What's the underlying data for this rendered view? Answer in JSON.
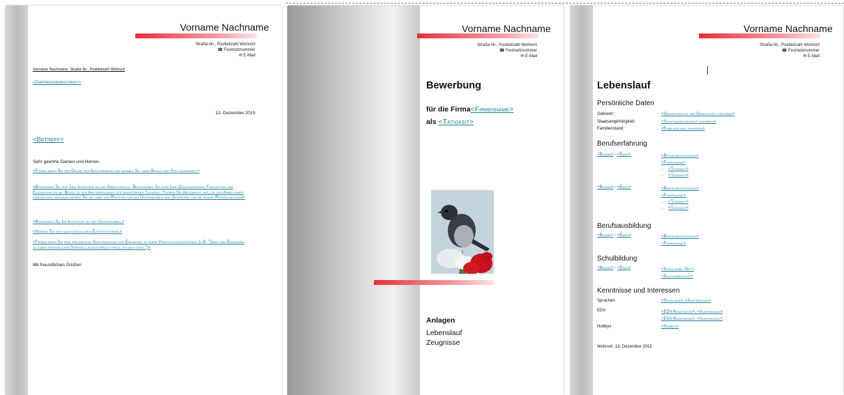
{
  "header": {
    "name": "Vorname Nachname",
    "address": "Straße-Nr., Postleitzahl  Wohnort",
    "phone": "☎ Festnetznummer",
    "email": "✉ E-Mail"
  },
  "letter": {
    "sender_line": "Vorname Nachname, Straße-Nr., Postleitzahl  Wohnort",
    "recipient": "<Empfängeranschrift>",
    "date": "13. Dezember 2015",
    "subject": "<Betreff>",
    "salutation": "Sehr geehrte Damen und Herren,",
    "paragraphs": [
      "<Formulieren Sie den Grund des Anschreibens und nehmen Sie darin Bezug zum Stellenangebot>",
      "<Begründen Sie hier Ihre Interesse an der Arbeitsstelle. Beschreiben Sie kurz Ihre Qualifikationen, Fähigkeiten und Eigenschaften mit Bezug zu den Anforderungen der angestreben Tätigkeit. Führen Sie Argumente auf, die den Arbeitgeber überzeugen, weshalb gerade Sie die oder der Richtige für das Unternehmen sind (Interesse für die eigene Person wecken)>",
      "<Begründen Sie Ihr Interesse an dem Unternehmen.>",
      "<Nennen Sie den nächstmöglichen Eintrittstermin.>",
      "<Formulieren Sie eine freundliche Aufforderung zur Einladung zu einem Vorstellungsgespräch (z.B. \"Über eine Einladung zu einem persönlichen Vorstellungsgespräch freue ich mich sehr.\")>"
    ],
    "closing": "Mit freundlichen Grüßen"
  },
  "cover": {
    "title": "Bewerbung",
    "firma_prefix": "für die Firma",
    "firma_value": "<Firmenname>",
    "als_prefix": "als",
    "als_value": "<Tätigkeit>",
    "anlagen_title": "Anlagen",
    "anlagen": [
      "Lebenslauf",
      "Zeugnisse"
    ]
  },
  "cv": {
    "title": "Lebenslauf",
    "personal": {
      "heading": "Persönliche Daten",
      "rows": [
        {
          "label": "Geboren :",
          "value": "<Geburtsdatum und Geburtsort eingeben>"
        },
        {
          "label": "Staatsangehörigkeit:",
          "value": "<Staatsangehörigkeit eingeben>"
        },
        {
          "label": "Familienstand:",
          "value": "<Familienstand eingeben>"
        }
      ]
    },
    "beruf": {
      "heading": "Berufserfahrung",
      "begin": "<Beginn>",
      "sep": " - ",
      "end": "<Ende>",
      "bez": "<Berufsbezeichnung>",
      "firma": "<Firmenname>",
      "taetigkeit": "<Tätigkeit>"
    },
    "ausbildung": {
      "heading": "Berufsausbildung"
    },
    "schule": {
      "heading": "Schulbildung",
      "name": "<Schulname, Ort>",
      "abschluss": "<Schulabschluss>"
    },
    "kenntnisse": {
      "heading": "Kenntnisse und Interessen",
      "sprachen_label": "Sprachen",
      "sprachen_value": "<Sprachen>, <Ausprägung>",
      "edv_label": "EDV",
      "edv_value": "<EDV-Kenntnisse>, <Ausprägung>",
      "hobbys_label": "Hobbys",
      "hobbys_value": "<Hobbys>"
    },
    "footer": "Wohnort, 13. Dezember 2015"
  }
}
